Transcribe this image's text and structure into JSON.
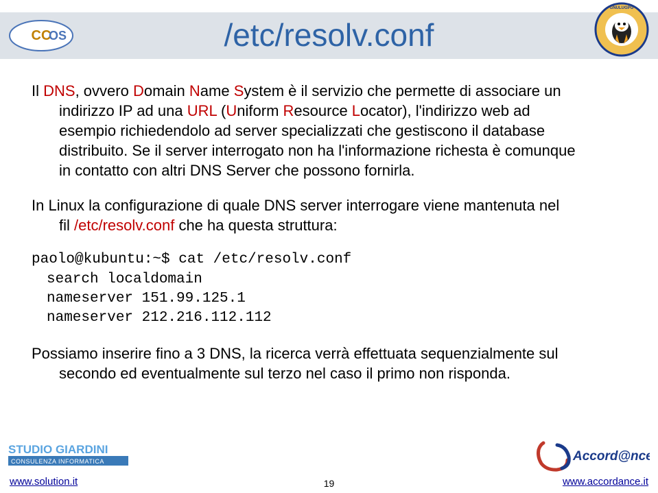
{
  "title": "/etc/resolv.conf",
  "para1": {
    "pre1": "Il ",
    "red1": "DNS",
    "mid1": ", ovvero ",
    "red2": "D",
    "mid2": "omain ",
    "red3": "N",
    "mid3": "ame ",
    "red4": "S",
    "mid4": "ystem è il servizio che permette di associare un ",
    "line2a": "indirizzo IP ad una ",
    "red5": "URL",
    "line2b": " (",
    "red6": "U",
    "line2c": "niform ",
    "red7": "R",
    "line2d": "esource ",
    "red8": "L",
    "line2e": "ocator), l'indirizzo web ad ",
    "line3": "esempio richiedendolo ad server specializzati che gestiscono il database ",
    "line4": "distribuito. Se il server interrogato non ha l'informazione richesta è comunque ",
    "line5": "in contatto con altri DNS Server che possono fornirla."
  },
  "para2": {
    "line1": "In Linux la configurazione di quale DNS server interrogare viene mantenuta nel ",
    "line2a": "fil ",
    "red": "/etc/resolv.conf",
    "line2b": " che ha questa struttura:"
  },
  "code": {
    "l1": "paolo@kubuntu:~$ cat /etc/resolv.conf",
    "l2": "search localdomain",
    "l3": "nameserver 151.99.125.1",
    "l4": "nameserver 212.216.112.112"
  },
  "para3": {
    "line1": "Possiamo inserire fino a 3 DNS, la ricerca verrà effettuata sequenzialmente sul ",
    "line2": "secondo ed eventualmente sul terzo nel caso il primo non risponda."
  },
  "footer": {
    "left_link": "www.solution.it",
    "right_link": "www.accordance.it",
    "page": "19"
  }
}
